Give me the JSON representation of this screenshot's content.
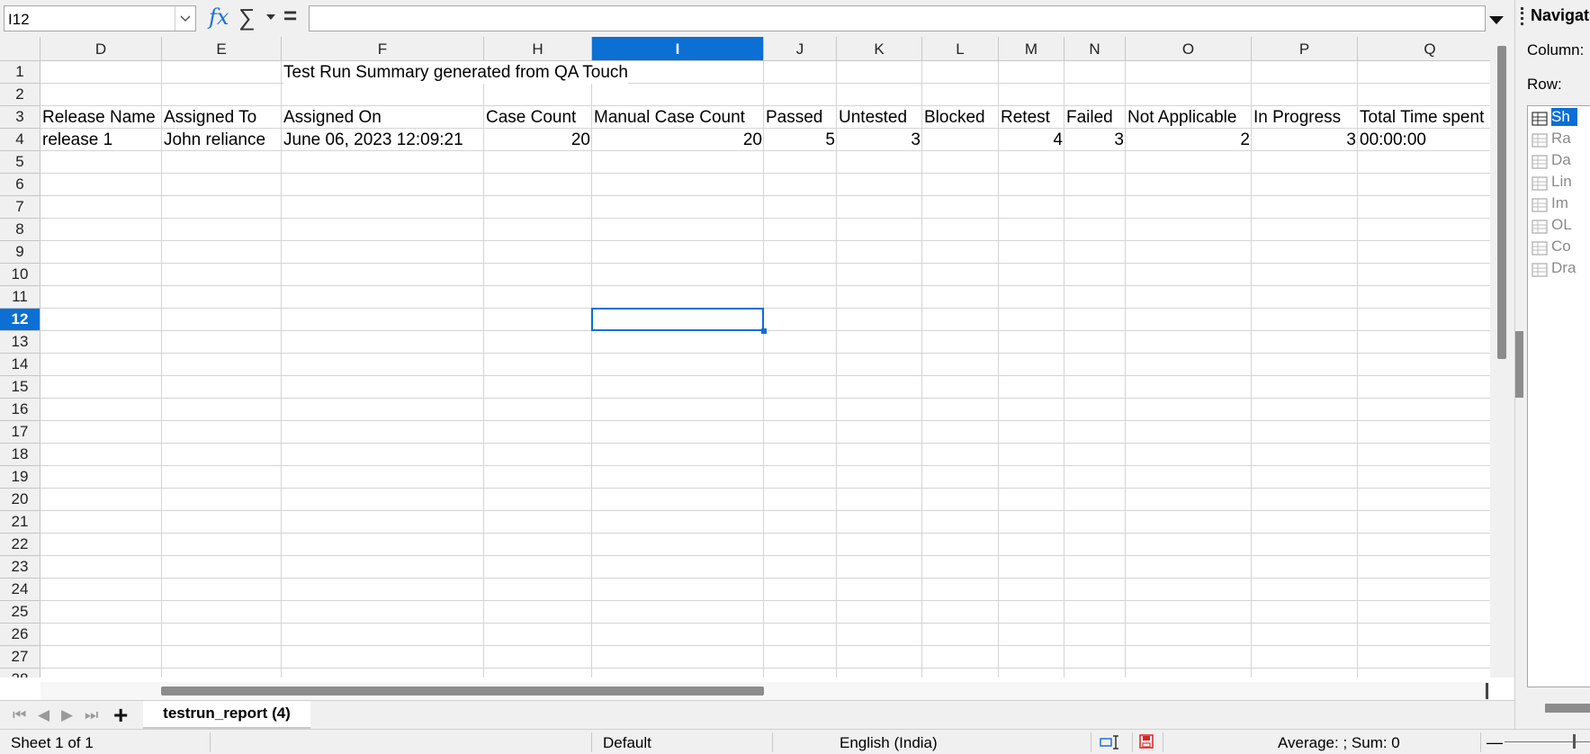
{
  "name_box": "I12",
  "formula": "",
  "formula_icons": {
    "function_wizard": "fx",
    "autosum": "∑",
    "formula": "="
  },
  "columns": [
    {
      "letter": "D"
    },
    {
      "letter": "E"
    },
    {
      "letter": "F"
    },
    {
      "letter": "H"
    },
    {
      "letter": "I",
      "selected": true
    },
    {
      "letter": "J"
    },
    {
      "letter": "K"
    },
    {
      "letter": "L"
    },
    {
      "letter": "M"
    },
    {
      "letter": "N"
    },
    {
      "letter": "O"
    },
    {
      "letter": "P"
    },
    {
      "letter": "Q"
    }
  ],
  "rows": [
    "1",
    "2",
    "3",
    "4",
    "5",
    "6",
    "7",
    "8",
    "9",
    "10",
    "11",
    "12",
    "13",
    "14",
    "15",
    "16",
    "17",
    "18",
    "19",
    "20",
    "21",
    "22",
    "23",
    "24",
    "25",
    "26",
    "27",
    "28"
  ],
  "selected_row": "12",
  "title_cell": "Test Run Summary generated from QA Touch",
  "header_row": [
    "Release Name",
    "Assigned To",
    "Assigned On",
    "Case Count",
    "Manual Case Count",
    "Passed",
    "Untested",
    "Blocked",
    "Retest",
    "Failed",
    "Not Applicable",
    "In Progress",
    "Total Time spent"
  ],
  "data_row": [
    "release 1",
    "John reliance",
    "June 06, 2023 12:09:21",
    "20",
    "20",
    "5",
    "3",
    "",
    "4",
    "3",
    "2",
    "3",
    "00:00:00"
  ],
  "sheet_tab": "testrun_report (4)",
  "status": {
    "sheet": "Sheet 1 of 1",
    "page_style": "Default",
    "language": "English (India)",
    "summary": "Average: ; Sum: 0"
  },
  "navigator": {
    "title": "Navigat",
    "column_label": "Column:",
    "row_label": "Row:",
    "items": [
      "Sh",
      "Ra",
      "Da",
      "Lin",
      "Im",
      "OL",
      "Co",
      "Dra"
    ]
  },
  "colors": {
    "selection": "#0b6fd4",
    "header_bg": "#f0f0f0",
    "gridline": "#d4d4d4"
  }
}
